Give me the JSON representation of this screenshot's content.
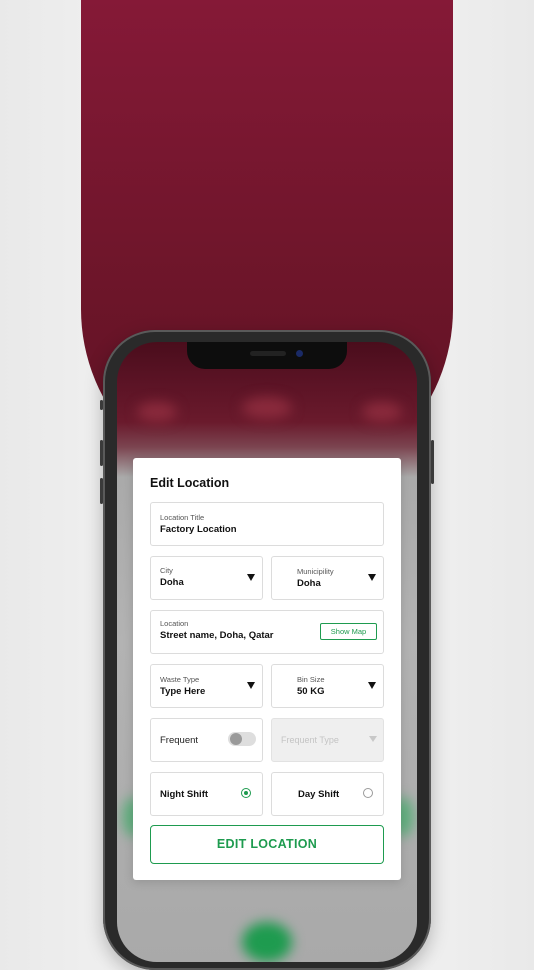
{
  "form": {
    "title": "Edit Location",
    "location_title": {
      "label": "Location Title",
      "value": "Factory Location"
    },
    "city": {
      "label": "City",
      "value": "Doha"
    },
    "municipality": {
      "label": "Municipility",
      "value": "Doha"
    },
    "location": {
      "label": "Location",
      "value": "Street name, Doha, Qatar",
      "map_button": "Show Map"
    },
    "waste_type": {
      "label": "Waste Type",
      "value": "Type Here"
    },
    "bin_size": {
      "label": "Bin Size",
      "value": "50 KG"
    },
    "frequent": {
      "label": "Frequent",
      "on": false
    },
    "frequent_type": {
      "placeholder": "Frequent Type"
    },
    "night_shift": {
      "label": "Night Shift",
      "selected": true
    },
    "day_shift": {
      "label": "Day Shift",
      "selected": false
    },
    "submit_label": "EDIT LOCATION"
  },
  "colors": {
    "accent": "#1e9b4f",
    "brand": "#7a1731"
  }
}
